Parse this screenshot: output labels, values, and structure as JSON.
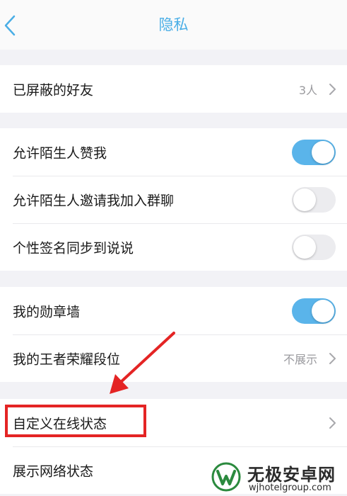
{
  "nav": {
    "title": "隐私"
  },
  "groups": [
    {
      "rows": [
        {
          "label": "已屏蔽的好友",
          "value": "3人",
          "control": "chevron"
        }
      ]
    },
    {
      "rows": [
        {
          "label": "允许陌生人赞我",
          "control": "toggle",
          "on": true
        },
        {
          "label": "允许陌生人邀请我加入群聊",
          "control": "toggle",
          "on": false
        },
        {
          "label": "个性签名同步到说说",
          "control": "toggle",
          "on": false
        }
      ]
    },
    {
      "rows": [
        {
          "label": "我的勋章墙",
          "control": "toggle",
          "on": true
        },
        {
          "label": "我的王者荣耀段位",
          "value": "不展示",
          "control": "chevron"
        }
      ]
    },
    {
      "rows": [
        {
          "label": "自定义在线状态",
          "control": "chevron"
        },
        {
          "label": "展示网络状态",
          "control": "none"
        }
      ]
    }
  ],
  "annotation": {
    "highlighted_item": "自定义在线状态",
    "color": "#e42424"
  },
  "watermark": {
    "name": "无极安卓网",
    "url": "wjhotelgroup.com"
  },
  "colors": {
    "accent": "#4aaee6",
    "toggle_on": "#5ab4ea",
    "background": "#f2f2f6"
  }
}
